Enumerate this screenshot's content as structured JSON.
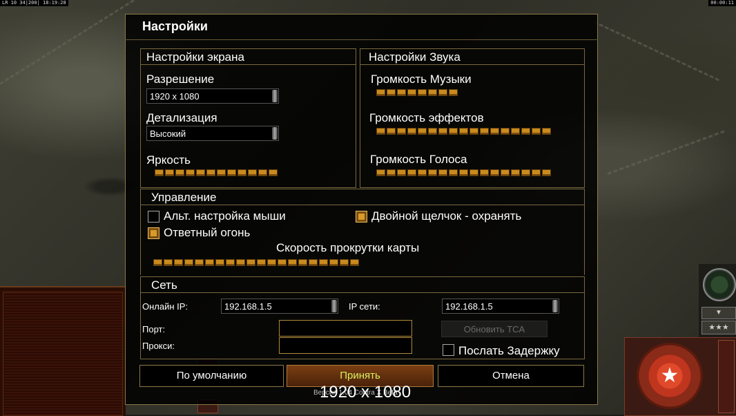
{
  "hud": {
    "left_text": "LR 10 34|200| 18:19:28",
    "right_text": "00:00:11"
  },
  "dialog": {
    "title": "Настройки"
  },
  "screen": {
    "title": "Настройки экрана",
    "resolution_label": "Разрешение",
    "resolution_value": "1920 x 1080",
    "detail_label": "Детализация",
    "detail_value": "Высокий",
    "brightness_label": "Яркость",
    "brightness_segments": 12
  },
  "sound": {
    "title": "Настройки Звука",
    "music_label": "Громкость Музыки",
    "music_segments": 8,
    "effects_label": "Громкость эффектов",
    "effects_segments": 17,
    "voice_label": "Громкость Голоса",
    "voice_segments": 17
  },
  "controls": {
    "title": "Управление",
    "alt_mouse_label": "Альт. настройка мыши",
    "alt_mouse_checked": false,
    "double_click_label": "Двойной щелчок - охранять",
    "double_click_checked": true,
    "return_fire_label": "Ответный огонь",
    "return_fire_checked": true,
    "scroll_speed_label": "Скорость прокрутки карты",
    "scroll_speed_segments": 20
  },
  "network": {
    "title": "Сеть",
    "online_ip_label": "Онлайн IP:",
    "online_ip_value": "192.168.1.5",
    "lan_ip_label": "IP сети:",
    "lan_ip_value": "192.168.1.5",
    "port_label": "Порт:",
    "proxy_label": "Прокси:",
    "update_tca_label": "Обновить TCA",
    "send_delay_label": "Послать Задержку",
    "send_delay_checked": false
  },
  "buttons": {
    "defaults_label": "По умолчанию",
    "accept_label": "Принять",
    "cancel_label": "Отмена"
  },
  "tooltip": {
    "big_text": "1920 x 1080",
    "small_text": "Версия 1.04 Contra X Beta"
  },
  "colors": {
    "accent": "#c98a1e",
    "frame": "#8b7a45",
    "primary_button_text": "#d8f060"
  }
}
